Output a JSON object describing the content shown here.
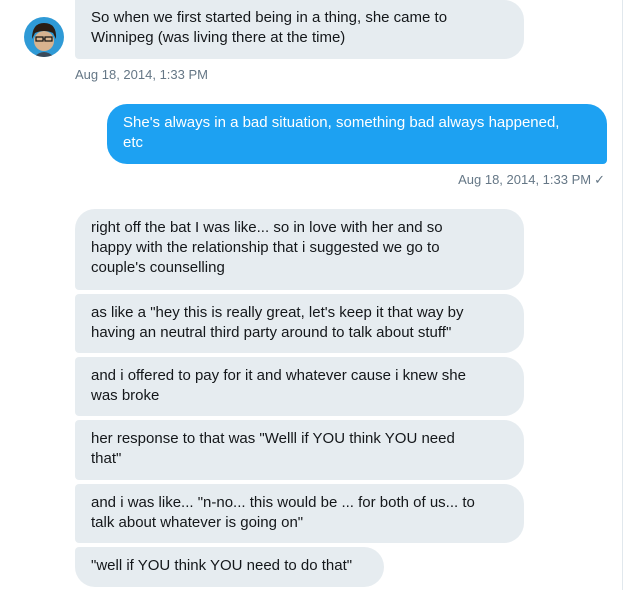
{
  "conversation": {
    "first_received": {
      "text": "So when we first started being in a thing, she came to\nWinnipeg (was living there at the time)",
      "timestamp": "Aug 18, 2014, 1:33 PM"
    },
    "sent": {
      "text": "She's always in a bad situation, something bad always happened,\netc",
      "timestamp": "Aug 18, 2014, 1:33 PM",
      "read_mark": "✓"
    },
    "received_group": [
      {
        "text": "right off the bat I was like... so in love with her and so\nhappy with the relationship that i suggested we go to\ncouple's counselling"
      },
      {
        "text": "as like a \"hey this is really great, let's keep it that way by\nhaving an neutral third party around to talk about stuff\""
      },
      {
        "text": "and i offered to pay for it and whatever cause i knew she\nwas broke"
      },
      {
        "text": "her response to that was \"Welll if YOU think YOU need\nthat\""
      },
      {
        "text": "and i was like... \"n-no... this would be ... for both of us... to\ntalk about whatever is going on\""
      },
      {
        "text": "\"well if YOU think YOU need to do that\""
      }
    ]
  },
  "icons": {
    "avatar": "user-avatar-illustration",
    "read_receipt": "checkmark-icon"
  },
  "colors": {
    "sent_bubble": "#1da1f2",
    "received_bubble": "#e6ecf0",
    "meta_text": "#657786"
  }
}
